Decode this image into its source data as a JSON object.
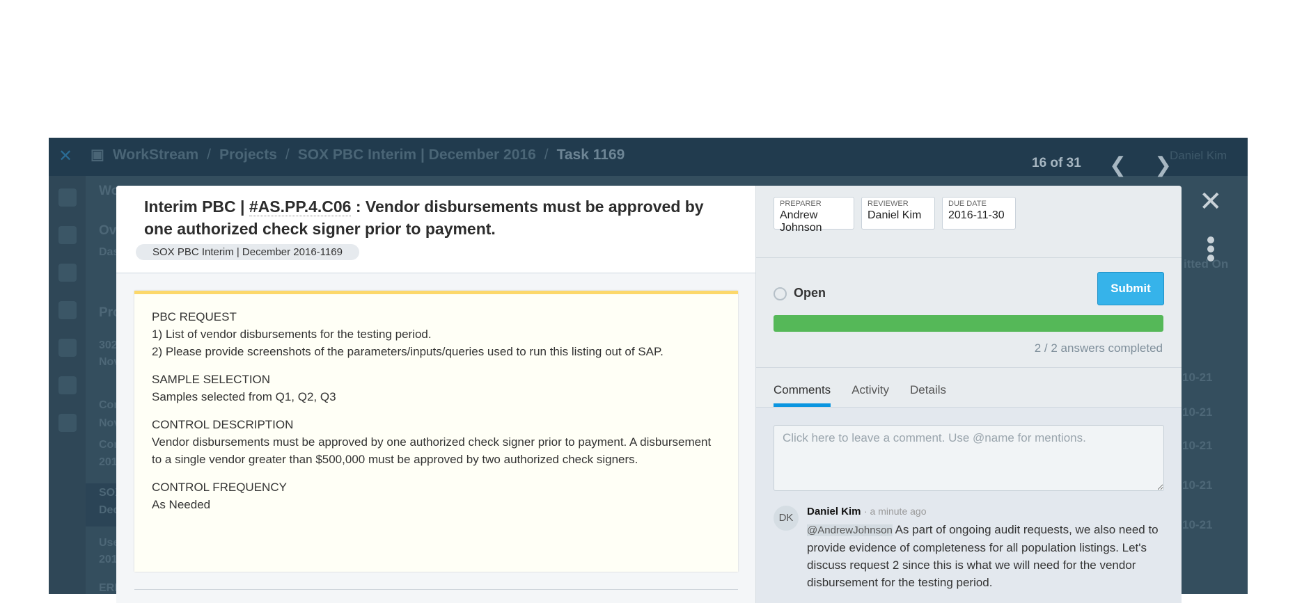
{
  "background": {
    "breadcrumb": [
      "WorkStream",
      "Projects",
      "SOX PBC Interim | December 2016",
      "Task 1169"
    ],
    "pager": "16 of 31",
    "user": "Daniel Kim",
    "column_fragments": [
      "Wo",
      "Ov",
      "Das",
      "Pro",
      "302",
      "Nov",
      "Con",
      "Nov",
      "Con",
      "201",
      "SOX",
      "Dec",
      "Use",
      "201",
      "ERI"
    ],
    "column_header": "itted On",
    "date_fragments": [
      "10-21",
      "10-21",
      "10-21",
      "10-21",
      "10-21"
    ]
  },
  "modal": {
    "title_prefix": "Interim PBC | ",
    "title_code": "#AS.PP.4.C06",
    "title_rest": " : Vendor disbursements must be approved by one authorized check signer prior to payment.",
    "tag": "SOX PBC Interim | December 2016-1169",
    "sections": [
      {
        "heading": "PBC REQUEST",
        "lines": [
          "1) List of vendor disbursements for the testing period.",
          "2) Please provide screenshots of the parameters/inputs/queries used to run this listing out of SAP."
        ]
      },
      {
        "heading": "SAMPLE SELECTION",
        "lines": [
          "Samples selected from Q1, Q2, Q3"
        ]
      },
      {
        "heading": "CONTROL DESCRIPTION",
        "lines": [
          "Vendor disbursements must be approved by one authorized check signer prior to payment. A disbursement to a single vendor greater than $500,000 must be approved by two authorized check signers."
        ]
      },
      {
        "heading": "CONTROL FREQUENCY",
        "lines": [
          "As Needed"
        ]
      }
    ],
    "fields": [
      {
        "label": "PREPARER",
        "value": "Andrew Johnson"
      },
      {
        "label": "REVIEWER",
        "value": "Daniel Kim"
      },
      {
        "label": "DUE DATE",
        "value": "2016-11-30"
      }
    ],
    "status": "Open",
    "submit_label": "Submit",
    "progress_percent": 100,
    "progress_color": "#55b858",
    "accent_color": "#36b3ea",
    "answers_completed": "2 / 2 answers completed",
    "tabs": [
      "Comments",
      "Activity",
      "Details"
    ],
    "active_tab": "Comments",
    "comment_placeholder": "Click here to leave a comment. Use @name for mentions.",
    "comments": [
      {
        "initials": "DK",
        "author": "Daniel Kim",
        "time": "· a minute ago",
        "mention": "@AndrewJohnson",
        "text": " As part of ongoing audit requests, we also need to provide evidence of completeness for all population listings. Let's discuss request 2 since this is what we will need for the vendor disbursement for the testing period."
      }
    ]
  }
}
